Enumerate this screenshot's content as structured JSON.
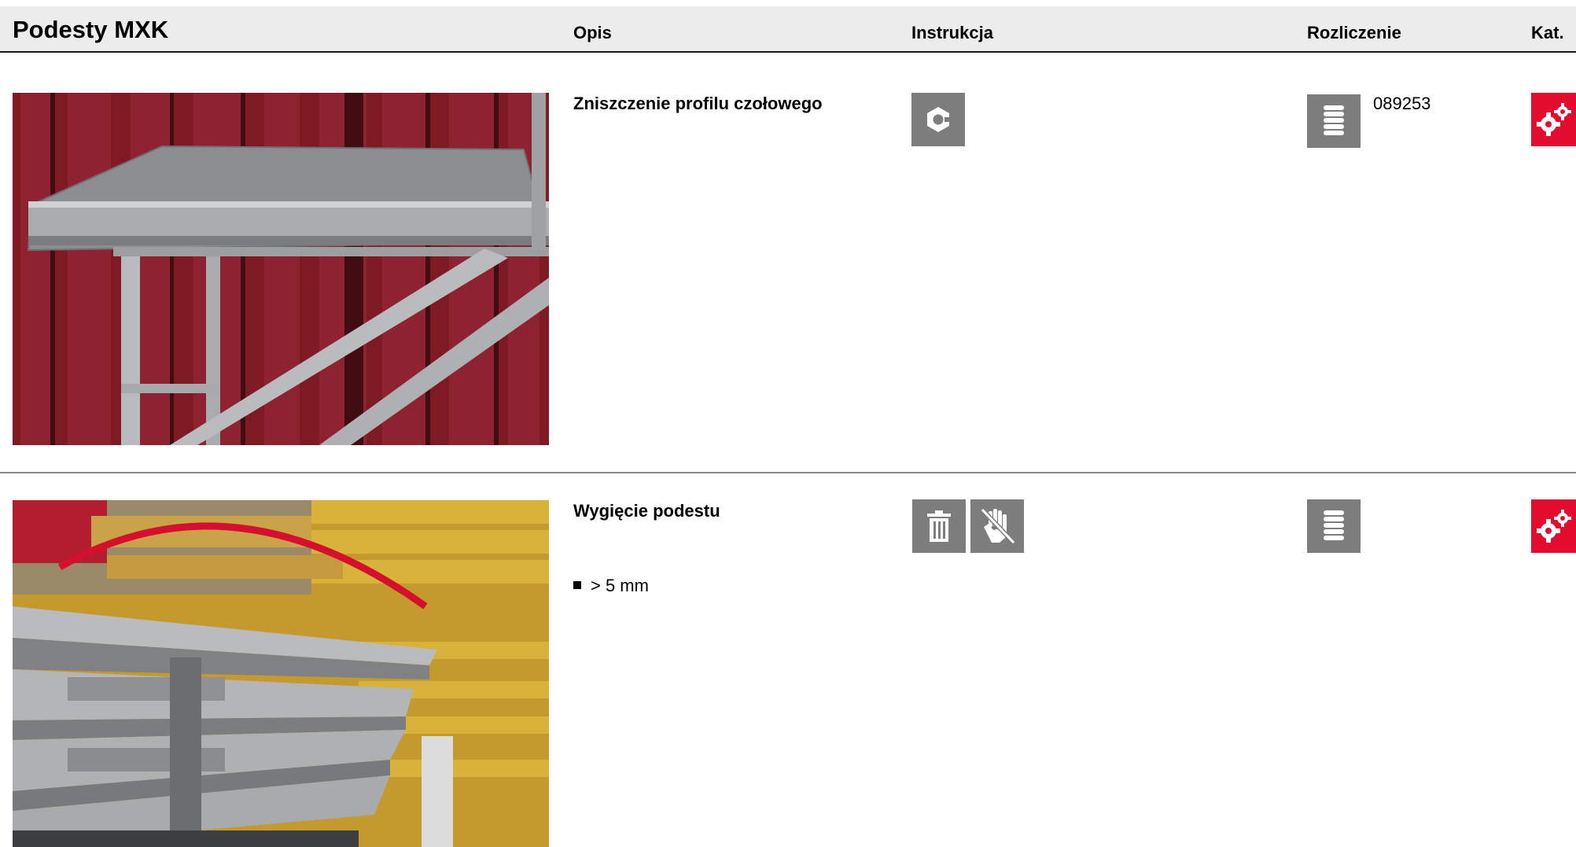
{
  "header": {
    "title": "Podesty MXK",
    "col_opis": "Opis",
    "col_instrukcja": "Instrukcja",
    "col_rozliczenie": "Rozliczenie",
    "col_kat": "Kat."
  },
  "rows": [
    {
      "description": "Zniszczenie profilu czołowego",
      "instruction_icons": [
        "nut-icon"
      ],
      "billing_icon": "stack-icon",
      "billing_code": "089253",
      "category_icon": "gears-icon",
      "colors": {
        "icon_bg": "#7d7d7d",
        "category_bg": "#e30b2e"
      }
    },
    {
      "description": "Wygięcie podestu",
      "bullet": "> 5 mm",
      "instruction_icons": [
        "trash-icon",
        "no-touch-icon"
      ],
      "billing_icon": "stack-icon",
      "category_icon": "gears-icon",
      "colors": {
        "icon_bg": "#7d7d7d",
        "category_bg": "#e30b2e"
      }
    }
  ]
}
